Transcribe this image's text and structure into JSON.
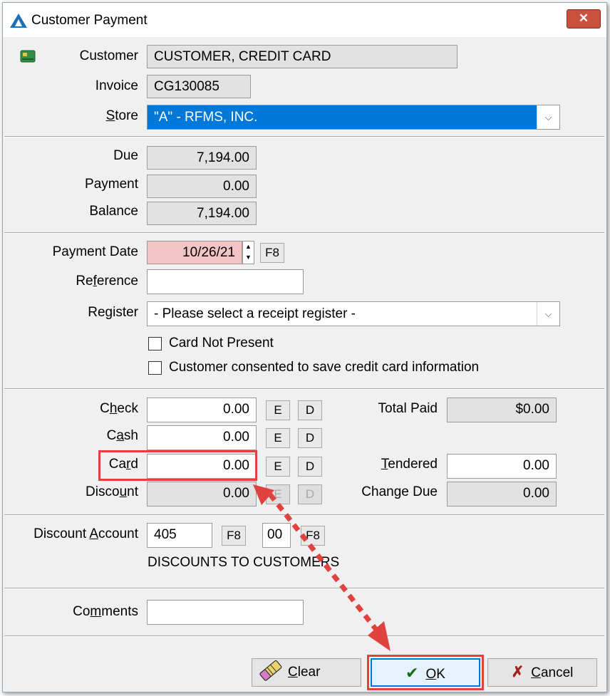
{
  "window": {
    "title": "Customer Payment",
    "close_label": "✕"
  },
  "header": {
    "customer_label_pre": "Customer",
    "customer_value": "CUSTOMER, CREDIT CARD",
    "invoice_label": "Invoice",
    "invoice_value": "CG130085",
    "store_label_u": "S",
    "store_label_rest": "tore",
    "store_value": "\"A\" - RFMS, INC."
  },
  "totals": {
    "due_label": "Due",
    "due_value": "7,194.00",
    "payment_label": "Payment",
    "payment_value": "0.00",
    "balance_label": "Balance",
    "balance_value": "7,194.00"
  },
  "details": {
    "payment_date_label": "Payment Date",
    "payment_date_value": "10/26/21",
    "f8_label": "F8",
    "reference_label_a": "Re",
    "reference_label_u": "f",
    "reference_label_b": "erence",
    "reference_value": "",
    "register_label_a": "Re",
    "register_label_u": "g",
    "register_label_b": "ister",
    "register_value": "- Please select a receipt register -",
    "card_not_present": "Card Not Present",
    "consent": "Customer consented to save credit card information"
  },
  "tenders": {
    "check_a": "C",
    "check_u": "h",
    "check_b": "eck",
    "check_value": "0.00",
    "cash_a": "C",
    "cash_u": "a",
    "cash_b": "sh",
    "cash_value": "0.00",
    "card_a": "Ca",
    "card_u": "r",
    "card_b": "d",
    "card_value": "0.00",
    "discount_a": "Disco",
    "discount_u": "u",
    "discount_b": "nt",
    "discount_value": "0.00",
    "e_label": "E",
    "d_label": "D",
    "total_paid_label": "Total Paid",
    "total_paid_value": "$0.00",
    "tendered_u": "T",
    "tendered_b": "endered",
    "tendered_value": "0.00",
    "change_due_label": "Change Due",
    "change_due_value": "0.00"
  },
  "discount_account": {
    "label_a": "Discount ",
    "label_u": "A",
    "label_b": "ccount",
    "account_value": "405",
    "f8_label": "F8",
    "sub_value": "00",
    "description": "DISCOUNTS TO CUSTOMERS"
  },
  "comments": {
    "label_a": "Co",
    "label_u": "m",
    "label_b": "ments",
    "value": ""
  },
  "buttons": {
    "clear_u": "C",
    "clear_b": "lear",
    "ok_u": "O",
    "ok_b": "K",
    "cancel_u": "C",
    "cancel_b": "ancel"
  },
  "colors": {
    "accent": "#0078d7",
    "highlight": "#e0423f",
    "date_bg": "#f2c4c4"
  }
}
